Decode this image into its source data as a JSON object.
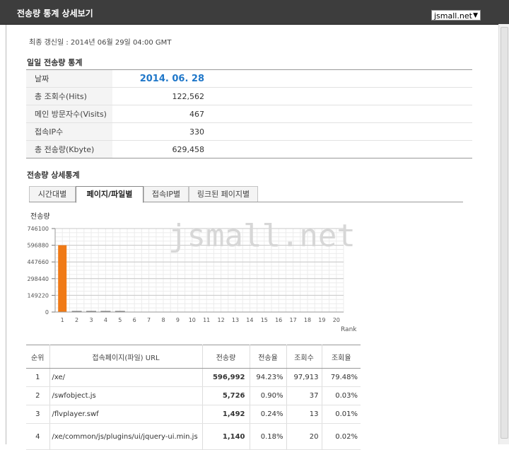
{
  "window": {
    "title": "전송량 통계 상세보기",
    "site_selected": "jsmall.net"
  },
  "updated_text": "최종 갱신일 : 2014년 06월 29일 04:00 GMT",
  "daily": {
    "title": "일일 전송량 통계",
    "rows": [
      {
        "label": "날짜",
        "value": "2014. 06. 28"
      },
      {
        "label": "총 조회수(Hits)",
        "value": "122,562"
      },
      {
        "label": "메인 방문자수(Visits)",
        "value": "467"
      },
      {
        "label": "접속IP수",
        "value": "330"
      },
      {
        "label": "총 전송량(Kbyte)",
        "value": "629,458"
      }
    ]
  },
  "detail": {
    "title": "전송량 상세통계",
    "tabs": [
      "시간대별",
      "페이지/파일별",
      "접속IP별",
      "링크된 페이지별"
    ],
    "active_tab": 1
  },
  "chart_data": {
    "type": "bar",
    "watermark": "jsmall.net",
    "ylabel": "전송량",
    "xlabel": "Rank",
    "yticks": [
      "746100",
      "596880",
      "447660",
      "298440",
      "149220",
      "0"
    ],
    "ylim": [
      0,
      746100
    ],
    "categories": [
      "1",
      "2",
      "3",
      "4",
      "5",
      "6",
      "7",
      "8",
      "9",
      "10",
      "11",
      "12",
      "13",
      "14",
      "15",
      "16",
      "17",
      "18",
      "19",
      "20"
    ],
    "values": [
      596992,
      5726,
      1492,
      1140,
      1000,
      0,
      0,
      0,
      0,
      0,
      0,
      0,
      0,
      0,
      0,
      0,
      0,
      0,
      0,
      0
    ],
    "bar_color": "#f07a16",
    "grid": true
  },
  "pages_table": {
    "headers": [
      "순위",
      "접속페이지(파일) URL",
      "전송량",
      "전송율",
      "조회수",
      "조회율"
    ],
    "rows": [
      {
        "rank": "1",
        "url": "/xe/",
        "transfer": "596,992",
        "transfer_rate": "94.23%",
        "hits": "97,913",
        "hit_rate": "79.48%"
      },
      {
        "rank": "2",
        "url": "/swfobject.js",
        "transfer": "5,726",
        "transfer_rate": "0.90%",
        "hits": "37",
        "hit_rate": "0.03%"
      },
      {
        "rank": "3",
        "url": "/flvplayer.swf",
        "transfer": "1,492",
        "transfer_rate": "0.24%",
        "hits": "13",
        "hit_rate": "0.01%"
      },
      {
        "rank": "4",
        "url": "/xe/common/js/plugins/ui/jquery-ui.min.js",
        "transfer": "1,140",
        "transfer_rate": "0.18%",
        "hits": "20",
        "hit_rate": "0.02%"
      }
    ]
  }
}
